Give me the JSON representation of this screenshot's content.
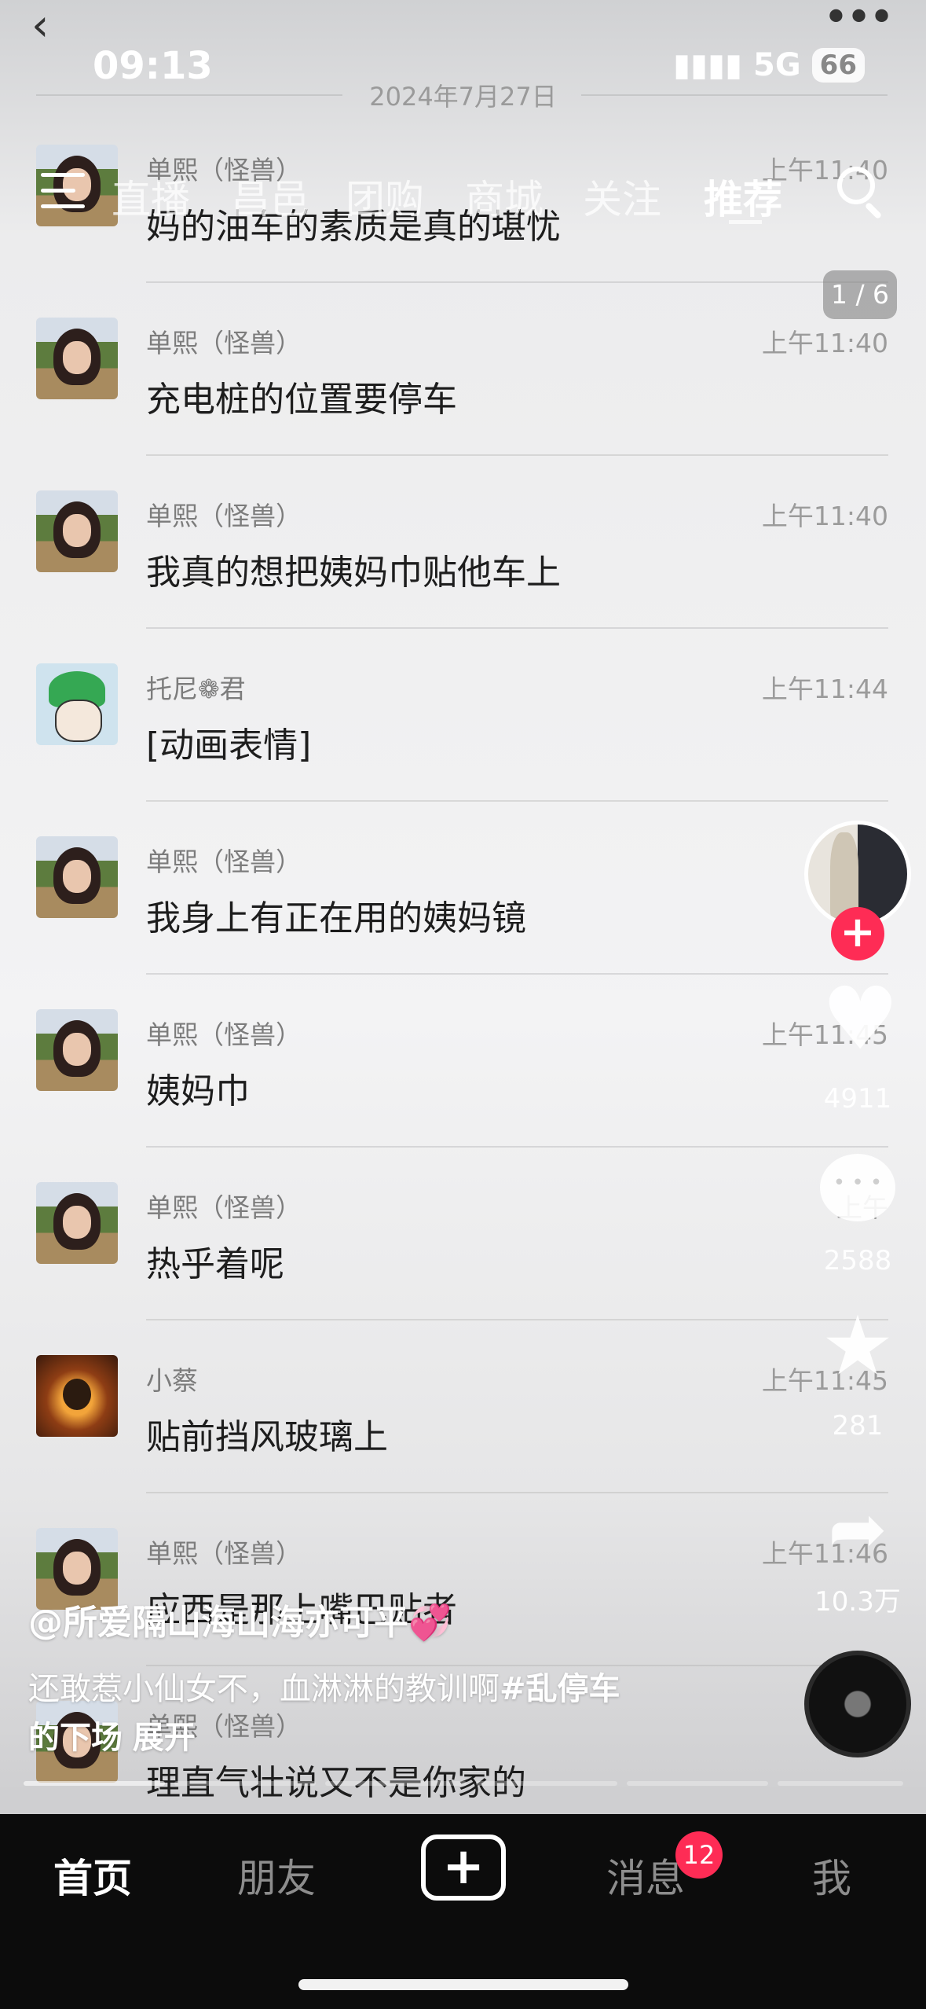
{
  "status_bar": {
    "time": "09:13",
    "network": "5G",
    "battery": "66"
  },
  "chat": {
    "date": "2024年7月27日",
    "messages": [
      {
        "sender": "单熙（怪兽）",
        "time": "上午11:40",
        "text": "妈的油车的素质是真的堪忧",
        "avatar": "girl"
      },
      {
        "sender": "单熙（怪兽）",
        "time": "上午11:40",
        "text": "充电桩的位置要停车",
        "avatar": "girl"
      },
      {
        "sender": "单熙（怪兽）",
        "time": "上午11:40",
        "text": "我真的想把姨妈巾贴他车上",
        "avatar": "girl"
      },
      {
        "sender": "托尼❁君",
        "time": "上午11:44",
        "text": "[动画表情]",
        "avatar": "zoro"
      },
      {
        "sender": "单熙（怪兽）",
        "time": "上午",
        "text": "我身上有正在用的姨妈镜",
        "avatar": "girl"
      },
      {
        "sender": "单熙（怪兽）",
        "time": "上午11:45",
        "text": "姨妈巾",
        "avatar": "girl"
      },
      {
        "sender": "单熙（怪兽）",
        "time": "上午",
        "text": "热乎着呢",
        "avatar": "girl"
      },
      {
        "sender": "小蔡",
        "time": "上午11:45",
        "text": "贴前挡风玻璃上",
        "avatar": "panda"
      },
      {
        "sender": "单熙（怪兽）",
        "time": "上午11:46",
        "text": "应西是那上嘴巴贴者",
        "avatar": "girl"
      },
      {
        "sender": "单熙（怪兽）",
        "time": "上午",
        "text": "理直气壮说又不是你家的",
        "avatar": "girl"
      }
    ]
  },
  "top_nav": {
    "menu_icon": "hamburger-icon",
    "tabs": [
      "直播",
      "昌邑",
      "团购",
      "商城",
      "关注",
      "推荐"
    ],
    "active_tab": "推荐",
    "search_icon": "search-icon"
  },
  "page_counter": "1 / 6",
  "actions": {
    "likes": "4911",
    "comments": "2588",
    "favorites": "281",
    "shares": "10.3万"
  },
  "caption": {
    "author": "@所爱隔山海山海亦可平💞",
    "text": "还敢惹小仙女不，血淋淋的教训啊",
    "hashtag": "#乱停车",
    "text2": "的下场",
    "expand": "展开"
  },
  "bottom_nav": {
    "home": "首页",
    "friends": "朋友",
    "plus": "+",
    "messages": "消息",
    "messages_badge": "12",
    "me": "我"
  }
}
